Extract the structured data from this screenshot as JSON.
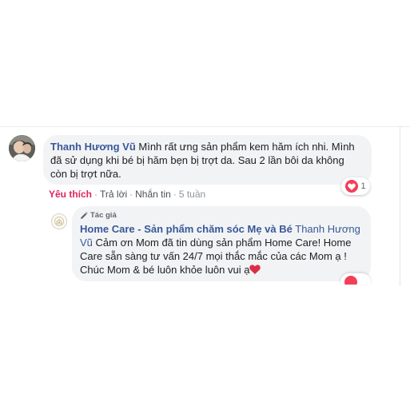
{
  "comment": {
    "author": "Thanh Hương Vũ",
    "text": "Mình rất ưng sản phẩm kem hăm ích nhi. Mình đã sử dụng khi bé bị hăm bẹn bị trợt da. Sau 2 lần bôi da không còn bị trợt nữa.",
    "actions": {
      "like": "Yêu thích",
      "reply": "Trả lời",
      "message": "Nhắn tin",
      "time": "5 tuần"
    },
    "reaction_count": "1"
  },
  "reply": {
    "badge": "Tác giả",
    "author": "Home Care - Sản phẩm chăm sóc Mẹ và Bé",
    "mention": "Thanh Hương Vũ",
    "text": "Cảm ơn Mom đã tin dùng sản phẩm Home Care! Home Care sẵn sàng tư vấn 24/7 mọi thắc mắc của các Mom ạ ! Chúc Mom & bé luôn khỏe luôn vui ạ"
  },
  "colors": {
    "link": "#385898",
    "like_red": "#e0245e",
    "heart": "#f33e58",
    "bubble_bg": "#f2f3f5"
  },
  "icons": {
    "reaction": "heart-icon",
    "badge": "pencil-icon",
    "page_avatar": "home-care-logo"
  }
}
